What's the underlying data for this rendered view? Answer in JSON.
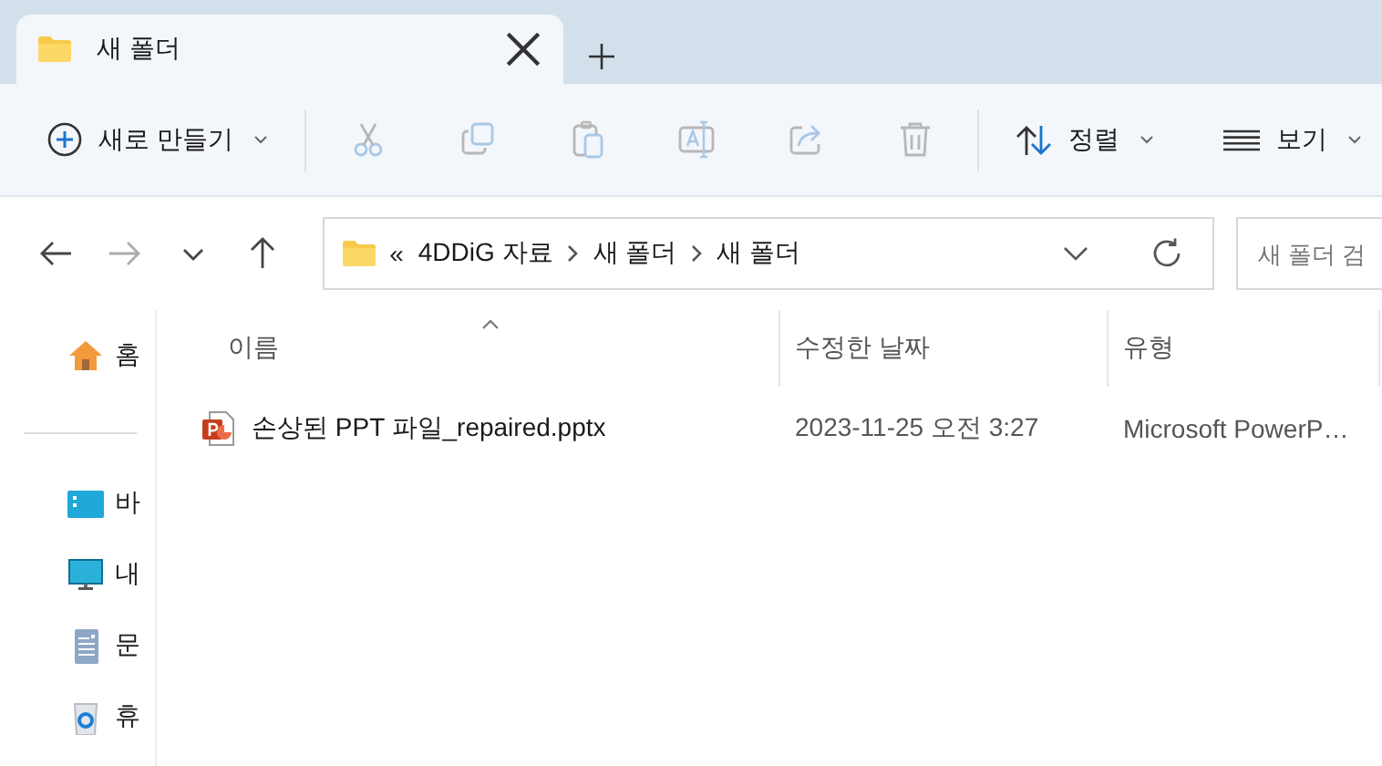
{
  "tab": {
    "title": "새 폴더",
    "selected": true
  },
  "toolbar": {
    "new_button": "새로 만들기",
    "actions": [
      {
        "kind": "cut",
        "disabled": true
      },
      {
        "kind": "copy",
        "disabled": true
      },
      {
        "kind": "paste",
        "disabled": true
      },
      {
        "kind": "rename",
        "disabled": true
      },
      {
        "kind": "share",
        "disabled": true
      },
      {
        "kind": "delete",
        "disabled": true
      }
    ],
    "sort_button": "정렬",
    "view_button": "보기"
  },
  "navigation": {
    "back_disabled": false,
    "forward_disabled": true
  },
  "address_bar": {
    "overflow": "«",
    "path": [
      "4DDiG 자료",
      "새 폴더",
      "새 폴더"
    ]
  },
  "search": {
    "placeholder": "새 폴더 검"
  },
  "sidebar": {
    "items": [
      {
        "kind": "home",
        "label": "홈"
      },
      {
        "kind": "divider"
      },
      {
        "kind": "gallery",
        "label": "바"
      },
      {
        "kind": "pc",
        "label": "내"
      },
      {
        "kind": "documents",
        "label": "문"
      },
      {
        "kind": "recycle",
        "label": "휴"
      }
    ]
  },
  "table": {
    "columns": [
      "이름",
      "수정한 날짜",
      "유형"
    ],
    "rows": [
      {
        "name": "손상된 PPT 파일_repaired.pptx",
        "modified": "2023-11-25 오전 3:27",
        "type": "Microsoft PowerP…",
        "selected": false
      }
    ]
  }
}
